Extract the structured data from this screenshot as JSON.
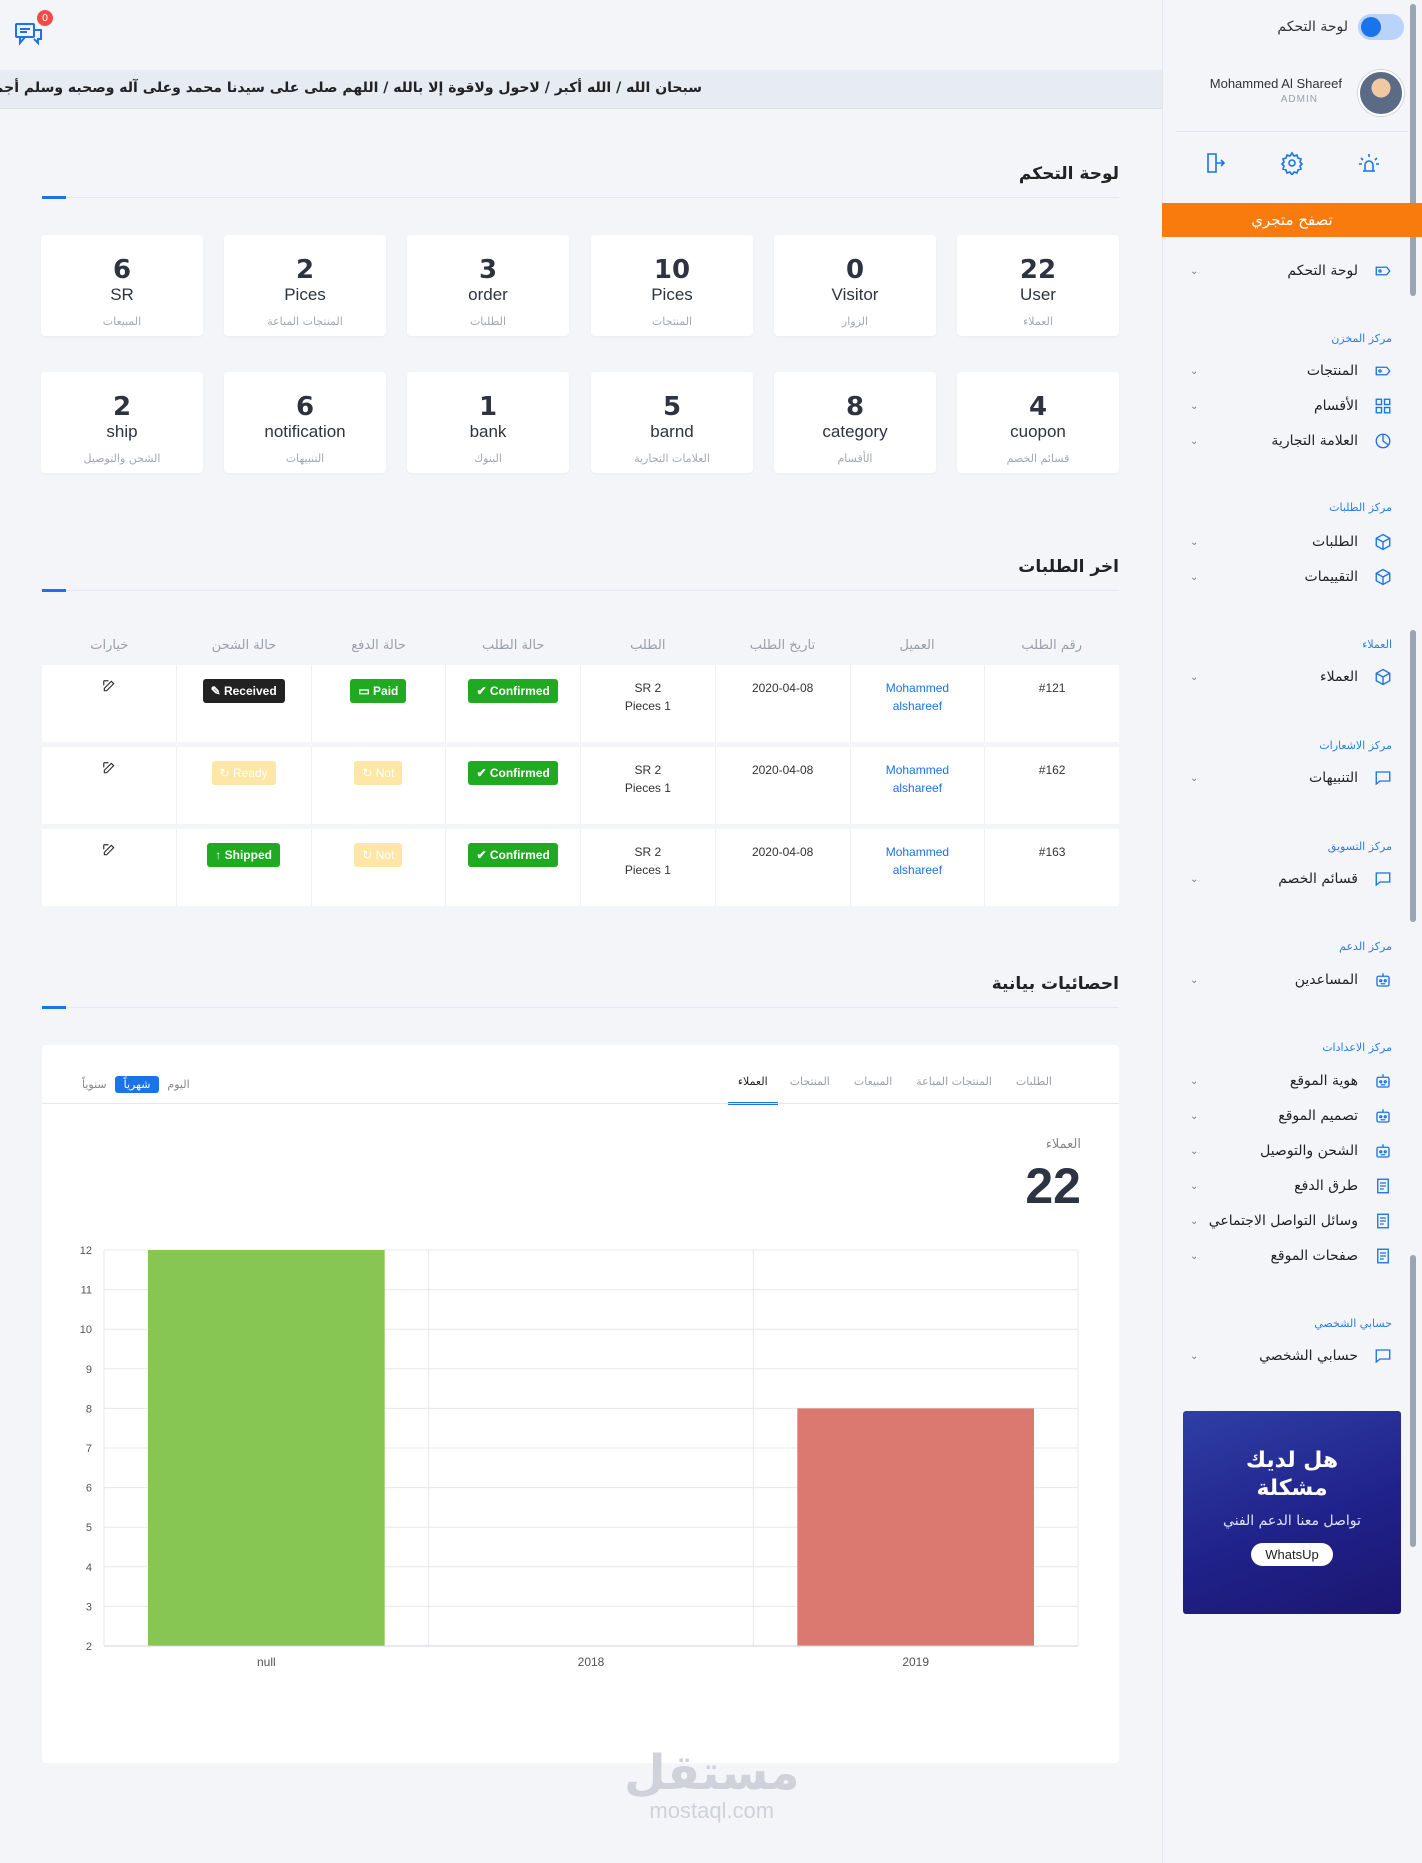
{
  "header": {
    "notification_count": "0",
    "ticker": "سبحان الله / الله أكبر / لاحول ولاقوة إلا بالله / اللهم صلى على سيدنا محمد وعلى آله وصحبه وسلم أجمعين / أسـ"
  },
  "sidebar": {
    "toggle_label": "لوحة التحكم",
    "user_name": "Mohammed Al Shareef",
    "user_role": "ADMIN",
    "store_button": "تصفح متجري",
    "dashboard_item": "لوحة التحكم",
    "sections": [
      {
        "title": "مركز المخزن",
        "items": [
          "المنتجات",
          "الأقسام",
          "العلامة التجارية"
        ]
      },
      {
        "title": "مركز الطلبات",
        "items": [
          "الطلبات",
          "التقييمات"
        ]
      },
      {
        "title": "العملاء",
        "items": [
          "العملاء"
        ]
      },
      {
        "title": "مركز الاشعارات",
        "items": [
          "التنبيهات"
        ]
      },
      {
        "title": "مركز التسويق",
        "items": [
          "قسائم الخصم"
        ]
      },
      {
        "title": "مركز الدعم",
        "items": [
          "المساعدين"
        ]
      },
      {
        "title": "مركز الاعدادات",
        "items": [
          "هوية الموقع",
          "تصميم الموقع",
          "الشحن والتوصيل",
          "طرق الدفع",
          "وسائل التواصل الاجتماعي",
          "صفحات الموقع"
        ]
      },
      {
        "title": "حسابي الشخصي",
        "items": [
          "حسابي الشخصي"
        ]
      }
    ],
    "help_card": {
      "title_line1": "هل لديك",
      "title_line2": "مشكلة",
      "subtitle": "تواصل معنا الدعم الفني",
      "button": "WhatsUp"
    }
  },
  "dashboard": {
    "title": "لوحة التحكم",
    "stats": [
      {
        "num": "22",
        "unit": "User",
        "label": "العملاء"
      },
      {
        "num": "0",
        "unit": "Visitor",
        "label": "الزوار"
      },
      {
        "num": "10",
        "unit": "Pices",
        "label": "المنتجات"
      },
      {
        "num": "3",
        "unit": "order",
        "label": "الطلبات"
      },
      {
        "num": "2",
        "unit": "Pices",
        "label": "المنتجات المباعة"
      },
      {
        "num": "6",
        "unit": "SR",
        "label": "المبيعات"
      },
      {
        "num": "4",
        "unit": "cuopon",
        "label": "قسائم الخصم"
      },
      {
        "num": "8",
        "unit": "category",
        "label": "الأقسام"
      },
      {
        "num": "5",
        "unit": "barnd",
        "label": "العلامات التجارية"
      },
      {
        "num": "1",
        "unit": "bank",
        "label": "البنوك"
      },
      {
        "num": "6",
        "unit": "notification",
        "label": "التنبيهات"
      },
      {
        "num": "2",
        "unit": "ship",
        "label": "الشحن والتوصيل"
      }
    ]
  },
  "orders": {
    "title": "اخر الطلبات",
    "columns": [
      "رقم الطلب",
      "العميل",
      "تاريخ الطلب",
      "الطلب",
      "حالة الطلب",
      "حالة الدفع",
      "حالة الشحن",
      "خيارات"
    ],
    "rows": [
      {
        "id": "#121",
        "customer_first": "Mohammed",
        "customer_last": "alshareef",
        "date": "2020-04-08",
        "price": "SR 2",
        "pieces": "Pieces 1",
        "status": "Confirmed",
        "payment": "Paid",
        "shipping": "Received"
      },
      {
        "id": "#162",
        "customer_first": "Mohammed",
        "customer_last": "alshareef",
        "date": "2020-04-08",
        "price": "SR 2",
        "pieces": "Pieces 1",
        "status": "Confirmed",
        "payment": "Not",
        "shipping": "Ready"
      },
      {
        "id": "#163",
        "customer_first": "Mohammed",
        "customer_last": "alshareef",
        "date": "2020-04-08",
        "price": "SR 2",
        "pieces": "Pieces 1",
        "status": "Confirmed",
        "payment": "Not",
        "shipping": "Shipped"
      }
    ]
  },
  "stats_section": {
    "title": "احصائيات بيانية",
    "tabs": [
      "الطلبات",
      "المنتجات المباعة",
      "المبيعات",
      "المنتجات",
      "العملاء"
    ],
    "active_tab": "العملاء",
    "periods": [
      "اليوم",
      "شهرياً",
      "سنوياً"
    ],
    "active_period": "شهرياً",
    "kpi_label": "العملاء",
    "kpi_value": "22"
  },
  "chart_data": {
    "type": "bar",
    "categories": [
      "null",
      "2018",
      "2019"
    ],
    "values": [
      12,
      null,
      8
    ],
    "colors": [
      "#88c653",
      null,
      "#d97970"
    ],
    "ylim": [
      2,
      12
    ],
    "yticks": [
      2,
      3,
      4,
      5,
      6,
      7,
      8,
      9,
      10,
      11,
      12
    ],
    "grid": true
  },
  "watermark": {
    "line1": "مستقل",
    "line2": "mostaql.com"
  },
  "colors": {
    "accent": "#1a73e8",
    "store_button": "#fa7b0d",
    "success": "#1faa21"
  }
}
